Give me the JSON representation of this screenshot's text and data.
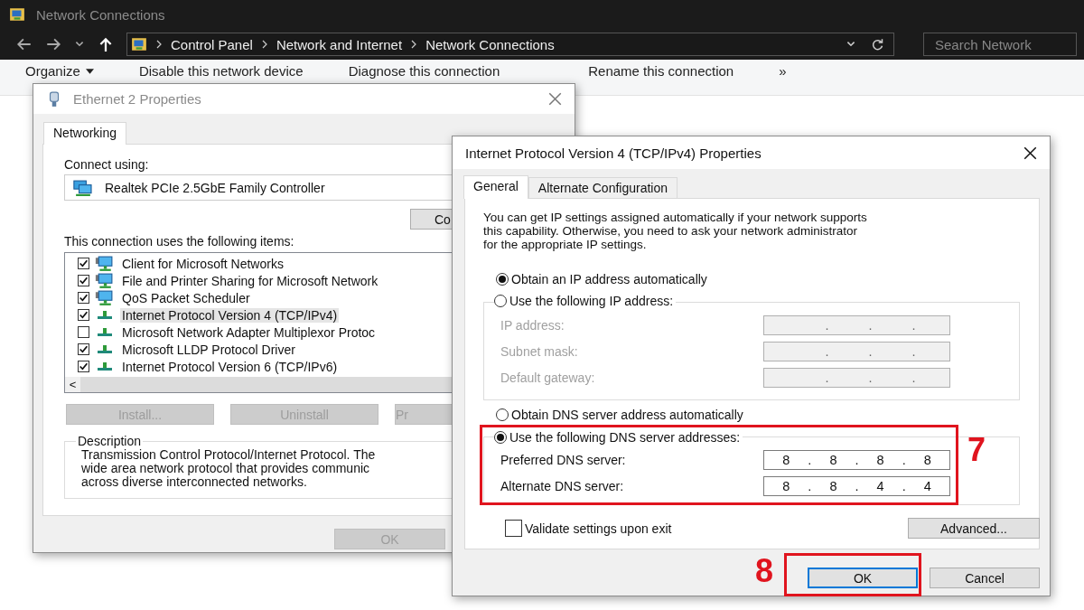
{
  "explorer": {
    "title": "Network Connections",
    "breadcrumbs": [
      "Control Panel",
      "Network and Internet",
      "Network Connections"
    ],
    "search": {
      "placeholder": "Search Network"
    },
    "commands": [
      {
        "label": "Organize",
        "menu": true
      },
      {
        "label": "Disable this network device",
        "menu": false
      },
      {
        "label": "Diagnose this connection",
        "menu": false
      },
      {
        "label": "Rename this connection",
        "menu": false
      },
      {
        "label": "»",
        "menu": false
      }
    ]
  },
  "ethernet_dialog": {
    "title": "Ethernet 2 Properties",
    "tabs": [
      {
        "label": "Networking",
        "selected": true
      }
    ],
    "connect_label": "Connect using:",
    "adapter": "Realtek PCIe 2.5GbE Family Controller",
    "configure_button": "Co",
    "items_label": "This connection uses the following items:",
    "items": [
      {
        "label": "Client for Microsoft Networks",
        "kind": "service",
        "checked": true,
        "selected": false
      },
      {
        "label": "File and Printer Sharing for Microsoft Network",
        "kind": "service",
        "checked": true,
        "selected": false
      },
      {
        "label": "QoS Packet Scheduler",
        "kind": "service",
        "checked": true,
        "selected": false
      },
      {
        "label": "Internet Protocol Version 4 (TCP/IPv4)",
        "kind": "protocol",
        "checked": true,
        "selected": true
      },
      {
        "label": "Microsoft Network Adapter Multiplexor Protoc",
        "kind": "protocol",
        "checked": false,
        "selected": false
      },
      {
        "label": "Microsoft LLDP Protocol Driver",
        "kind": "protocol",
        "checked": true,
        "selected": false
      },
      {
        "label": "Internet Protocol Version 6 (TCP/IPv6)",
        "kind": "protocol",
        "checked": true,
        "selected": false
      }
    ],
    "scroll_left": "<",
    "buttons": [
      {
        "label": "Install...",
        "disabled": true
      },
      {
        "label": "Uninstall",
        "disabled": true
      },
      {
        "label": "Pr",
        "disabled": true
      }
    ],
    "description": {
      "legend": "Description",
      "lines": [
        "Transmission Control Protocol/Internet Protocol. The",
        "wide area network protocol that provides communic",
        "across diverse interconnected networks."
      ]
    },
    "ok_button": {
      "label": "OK",
      "disabled": true
    }
  },
  "ipv4_dialog": {
    "title": "Internet Protocol Version 4 (TCP/IPv4) Properties",
    "tabs": [
      {
        "label": "General",
        "selected": true
      },
      {
        "label": "Alternate Configuration",
        "selected": false
      }
    ],
    "intro_lines": [
      "You can get IP settings assigned automatically if your network supports",
      "this capability. Otherwise, you need to ask your network administrator",
      "for the appropriate IP settings."
    ],
    "ip_mode": [
      {
        "label": "Obtain an IP address automatically",
        "selected": true
      },
      {
        "label": "Use the following IP address:",
        "selected": false
      }
    ],
    "ip_fields": [
      {
        "label": "IP address:",
        "value": ". . .",
        "disabled": true
      },
      {
        "label": "Subnet mask:",
        "value": ". . .",
        "disabled": true
      },
      {
        "label": "Default gateway:",
        "value": ". . .",
        "disabled": true
      }
    ],
    "dns_mode": [
      {
        "label": "Obtain DNS server address automatically",
        "selected": false
      },
      {
        "label": "Use the following DNS server addresses:",
        "selected": true
      }
    ],
    "dns_fields": [
      {
        "label": "Preferred DNS server:",
        "value": "8 . 8 . 8 . 8",
        "disabled": false
      },
      {
        "label": "Alternate DNS server:",
        "value": "8 . 8 . 4 . 4",
        "disabled": false
      }
    ],
    "validate": {
      "label": "Validate settings upon exit",
      "checked": false
    },
    "advanced_button": "Advanced...",
    "buttons": [
      {
        "label": "OK",
        "default": true
      },
      {
        "label": "Cancel",
        "default": false
      }
    ]
  },
  "annotations": [
    {
      "step": "7"
    },
    {
      "step": "8"
    }
  ]
}
